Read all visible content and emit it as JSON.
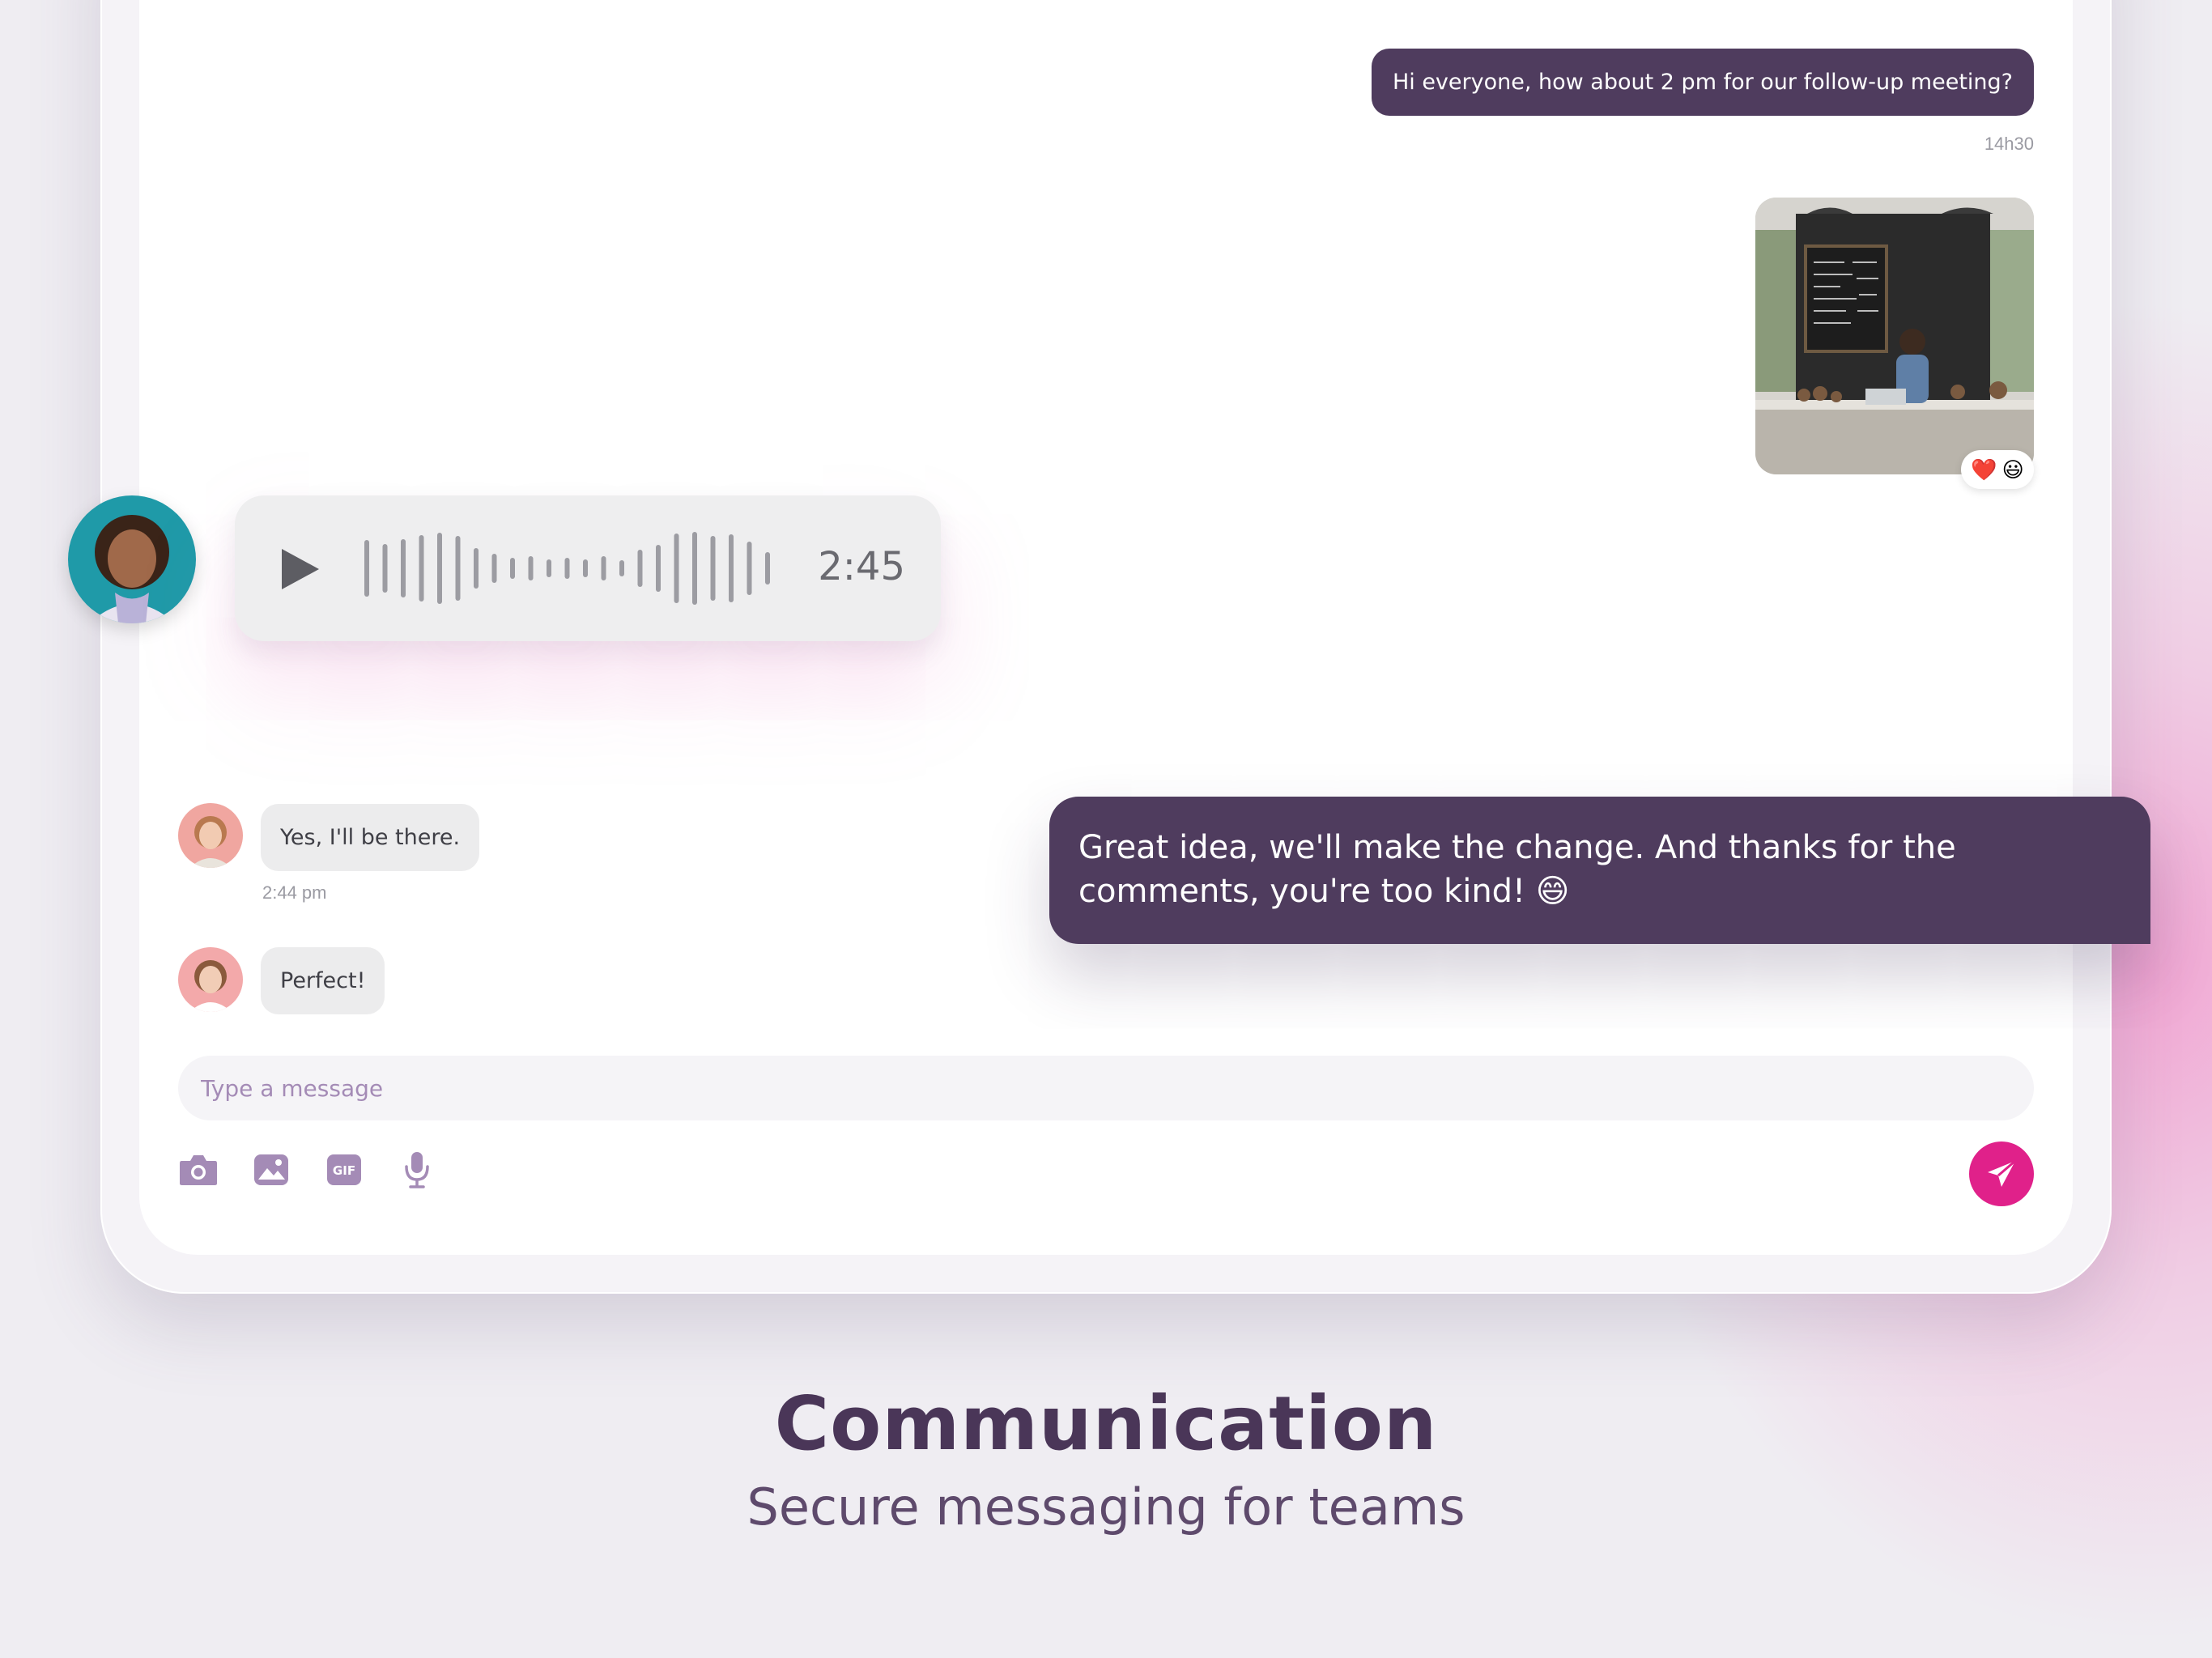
{
  "chat": {
    "outgoing_1": {
      "text": "Hi everyone, how about 2 pm for our follow-up meeting?",
      "time": "14h30"
    },
    "photo_message": {
      "image": "cafe-barista-photo",
      "reactions": [
        "❤️",
        "😃"
      ]
    },
    "voice_message": {
      "duration": "2:45",
      "play_icon": "play-icon"
    },
    "incoming_1": {
      "text": "Yes, I'll be there.",
      "time": "2:44 pm"
    },
    "incoming_2": {
      "text": "Perfect!"
    },
    "outgoing_big": {
      "text": "Great idea, we'll make the change. And thanks for the comments, you're too kind! 😄"
    }
  },
  "composer": {
    "placeholder": "Type a message",
    "tools": [
      "camera-icon",
      "image-icon",
      "gif-icon",
      "microphone-icon"
    ],
    "gif_label": "GIF",
    "send_icon": "send-icon"
  },
  "colors": {
    "outgoing_bubble": "#4f3c5e",
    "incoming_bubble": "#ececed",
    "accent": "#e0218a",
    "tool_icon": "#a48bb6"
  },
  "footer": {
    "title": "Communication",
    "subtitle": "Secure messaging for teams"
  }
}
